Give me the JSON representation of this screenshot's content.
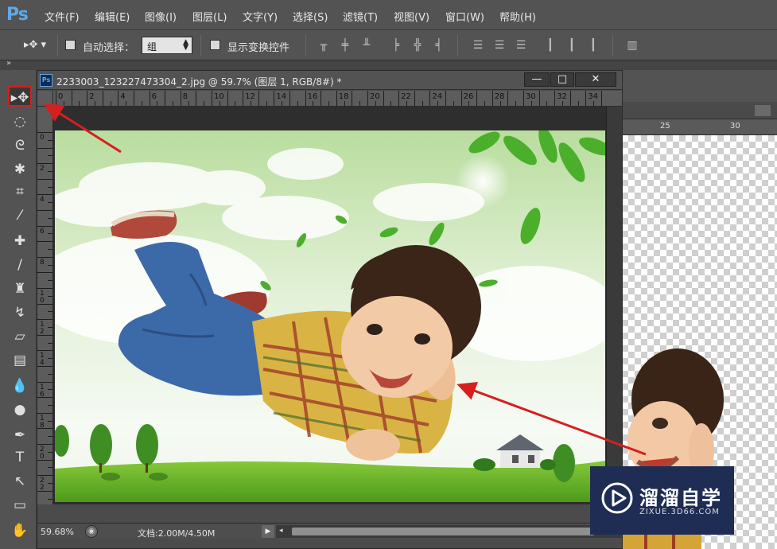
{
  "app": {
    "logo": "Ps"
  },
  "menu": [
    "文件(F)",
    "编辑(E)",
    "图像(I)",
    "图层(L)",
    "文字(Y)",
    "选择(S)",
    "滤镜(T)",
    "视图(V)",
    "窗口(W)",
    "帮助(H)"
  ],
  "options": {
    "tool_icon": "move-tool-icon",
    "auto_select_label": "自动选择：",
    "auto_select_checked": false,
    "target_value": "组",
    "show_transform_label": "显示变换控件",
    "show_transform_checked": false
  },
  "document": {
    "title": "2233003_123227473304_2.jpg @ 59.7% (图层 1, RGB/8#) *",
    "badge": "Ps",
    "buttons": {
      "minimize": "—",
      "maximize": "□",
      "close": "✕"
    },
    "ruler_h": [
      "0",
      "2",
      "4",
      "6",
      "8",
      "10",
      "12",
      "14",
      "16",
      "18",
      "20",
      "22",
      "24",
      "26",
      "28",
      "30",
      "32",
      "34"
    ],
    "ruler_v": [
      "0",
      "2",
      "4",
      "6",
      "8",
      "10",
      "12",
      "14",
      "16",
      "18",
      "20",
      "22"
    ]
  },
  "status": {
    "zoom": "59.68%",
    "doc_info": "文档:2.00M/4.50M"
  },
  "background_document": {
    "ruler_labels": [
      "25",
      "30"
    ]
  },
  "tools": [
    {
      "name": "move-tool",
      "glyph": "▸✥",
      "selected": true
    },
    {
      "name": "marquee-tool",
      "glyph": "◌"
    },
    {
      "name": "lasso-tool",
      "glyph": "ᘓ"
    },
    {
      "name": "magic-wand-tool",
      "glyph": "✱"
    },
    {
      "name": "crop-tool",
      "glyph": "⌗"
    },
    {
      "name": "eyedropper-tool",
      "glyph": "⁄"
    },
    {
      "name": "healing-brush-tool",
      "glyph": "✚"
    },
    {
      "name": "brush-tool",
      "glyph": "∕"
    },
    {
      "name": "stamp-tool",
      "glyph": "♜"
    },
    {
      "name": "history-brush-tool",
      "glyph": "↯"
    },
    {
      "name": "eraser-tool",
      "glyph": "▱"
    },
    {
      "name": "gradient-tool",
      "glyph": "▤"
    },
    {
      "name": "blur-tool",
      "glyph": "💧"
    },
    {
      "name": "dodge-tool",
      "glyph": "●"
    },
    {
      "name": "pen-tool",
      "glyph": "✒"
    },
    {
      "name": "type-tool",
      "glyph": "T"
    },
    {
      "name": "path-selection-tool",
      "glyph": "↖"
    },
    {
      "name": "shape-tool",
      "glyph": "▭"
    },
    {
      "name": "hand-tool",
      "glyph": "✋"
    }
  ],
  "watermark": {
    "title": "溜溜自学",
    "url": "ZIXUE.3D66.COM"
  },
  "colors": {
    "annotation_red": "#d61f1f",
    "ps_blue": "#5ea9e8",
    "panel_gray": "#535353"
  }
}
